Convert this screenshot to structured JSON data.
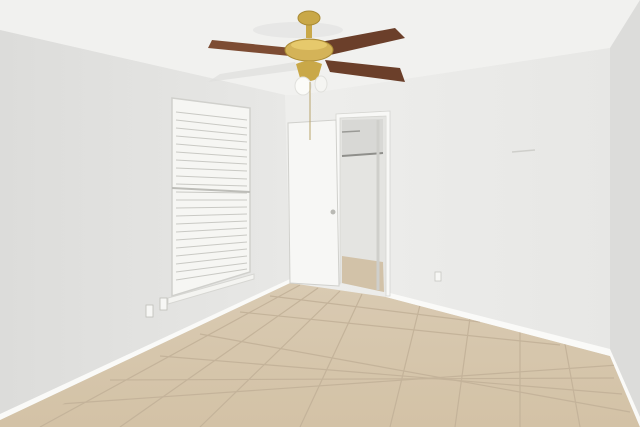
{
  "scene": {
    "subject": "empty-bedroom-interior",
    "elements": [
      "ceiling",
      "ceiling-fan",
      "window-with-blinds",
      "open-door",
      "walk-in-closet",
      "tile-floor",
      "baseboards",
      "electrical-outlets"
    ]
  },
  "colors": {
    "ceiling": "#f1f1ef",
    "left_wall": "#e2e2e0",
    "back_wall": "#ececea",
    "right_wall": "#dcdcda",
    "floor": "#d8c8ae",
    "grout": "#c4b39a",
    "baseboard": "#fafaf8",
    "fan_blade": "#6b3f2a",
    "fan_brass": "#c9a848",
    "door": "#f7f7f5",
    "closet_interior": "#dcdcd9",
    "blinds": "#f3f3f0"
  }
}
